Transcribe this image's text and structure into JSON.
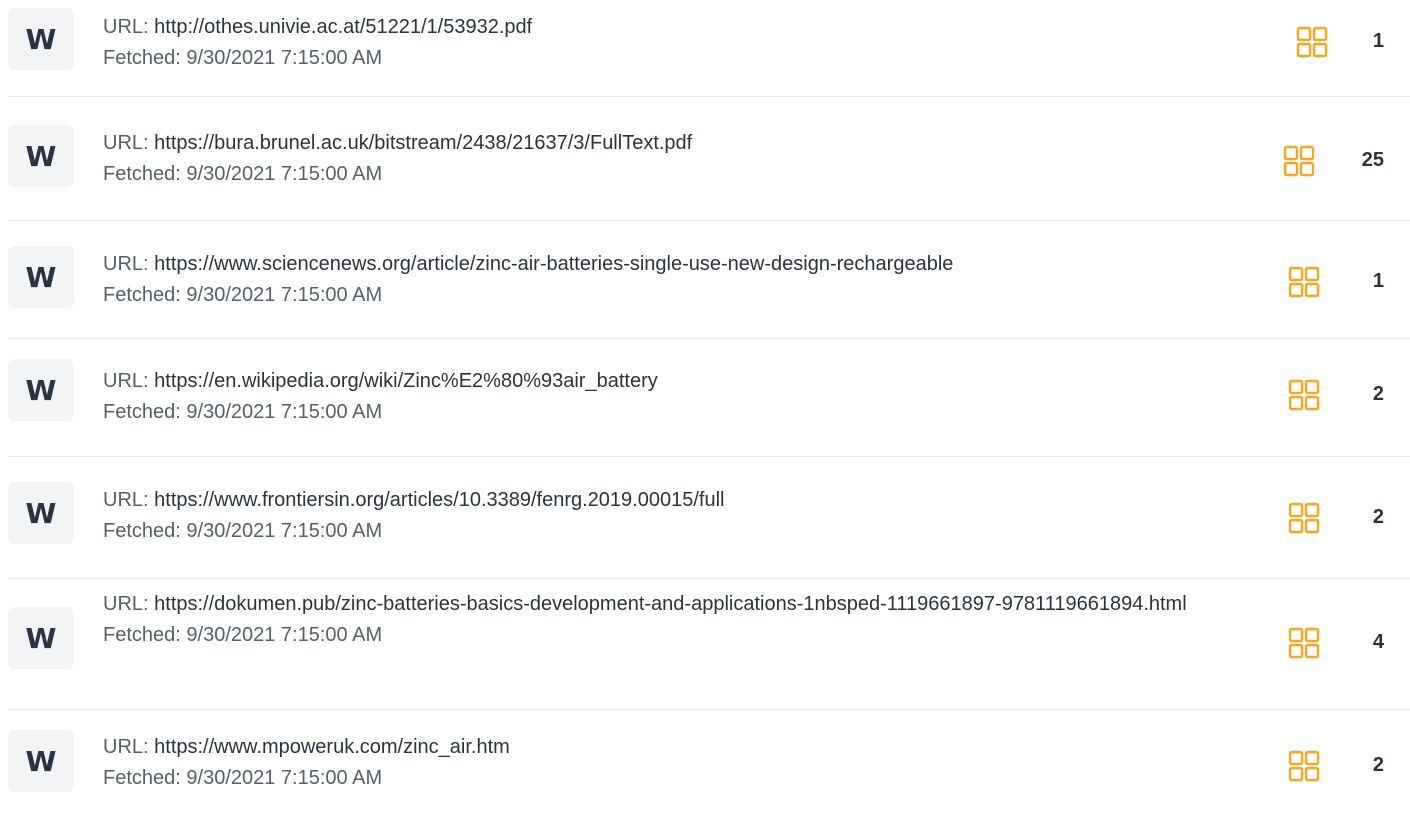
{
  "sources": [
    {
      "badge": "W",
      "url_label": "URL:",
      "url": "http://othes.univie.ac.at/51221/1/53932.pdf",
      "fetched_label": "Fetched:",
      "fetched": "9/30/2021 7:15:00 AM",
      "match_count": "1",
      "icon": "grid-icon"
    },
    {
      "badge": "W",
      "url_label": "URL:",
      "url": "https://bura.brunel.ac.uk/bitstream/2438/21637/3/FullText.pdf",
      "fetched_label": "Fetched:",
      "fetched": "9/30/2021 7:15:00 AM",
      "match_count": "25",
      "icon": "grid-icon"
    },
    {
      "badge": "W",
      "url_label": "URL:",
      "url": "https://www.sciencenews.org/article/zinc-air-batteries-single-use-new-design-rechargeable",
      "fetched_label": "Fetched:",
      "fetched": "9/30/2021 7:15:00 AM",
      "match_count": "1",
      "icon": "grid-icon"
    },
    {
      "badge": "W",
      "url_label": "URL:",
      "url": "https://en.wikipedia.org/wiki/Zinc%E2%80%93air_battery",
      "fetched_label": "Fetched:",
      "fetched": "9/30/2021 7:15:00 AM",
      "match_count": "2",
      "icon": "grid-icon"
    },
    {
      "badge": "W",
      "url_label": "URL:",
      "url": "https://www.frontiersin.org/articles/10.3389/fenrg.2019.00015/full",
      "fetched_label": "Fetched:",
      "fetched": "9/30/2021 7:15:00 AM",
      "match_count": "2",
      "icon": "grid-icon"
    },
    {
      "badge": "W",
      "url_label": "URL:",
      "url": "https://dokumen.pub/zinc-batteries-basics-development-and-applications-1nbsped-1119661897-9781119661894.html",
      "fetched_label": "Fetched:",
      "fetched": "9/30/2021 7:15:00 AM",
      "match_count": "4",
      "icon": "grid-icon"
    },
    {
      "badge": "W",
      "url_label": "URL:",
      "url": "https://www.mpoweruk.com/zinc_air.htm",
      "fetched_label": "Fetched:",
      "fetched": "9/30/2021 7:15:00 AM",
      "match_count": "2",
      "icon": "grid-icon"
    }
  ],
  "colors": {
    "icon_accent": "#f5a623",
    "badge_bg": "#f2f3f5",
    "divider": "#e4e6ea",
    "text_dark": "#2a3340",
    "text_muted": "#55606b"
  }
}
